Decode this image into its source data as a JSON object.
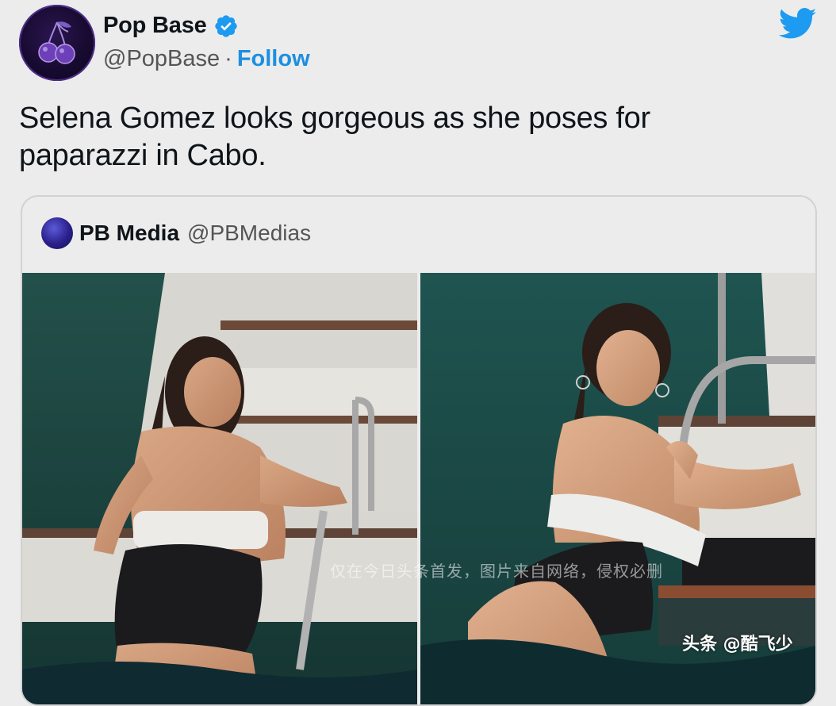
{
  "tweet": {
    "author": {
      "display_name": "Pop Base",
      "handle": "@PopBase",
      "separator": "·",
      "follow_label": "Follow",
      "verified": true,
      "avatar_icon": "cherries-icon"
    },
    "text": "Selena Gomez looks gorgeous as she poses for paparazzi in Cabo.",
    "platform_icon": "twitter-bird-icon"
  },
  "quoted_tweet": {
    "display_name": "PB Media",
    "handle": "@PBMedias",
    "photos": [
      {
        "name": "photo-left"
      },
      {
        "name": "photo-right"
      }
    ]
  },
  "overlays": {
    "watermark_text": "仅在今日头条首发，图片来自网络，侵权必删",
    "source_tag": "头条 @酷飞少"
  },
  "colors": {
    "background": "#ececec",
    "link_blue": "#1d8fe0",
    "verified_blue": "#1d9bf0",
    "sea_green": "#1f4a44"
  }
}
